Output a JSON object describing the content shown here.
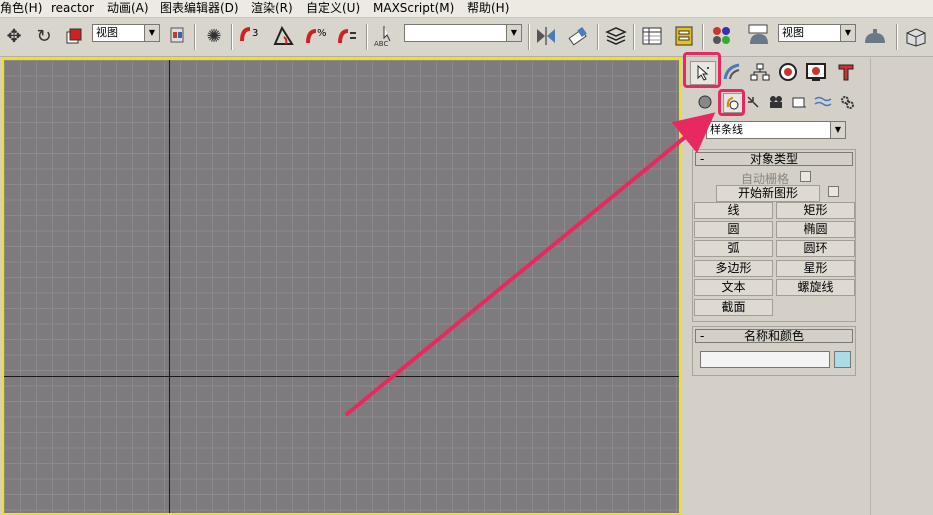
{
  "menu": [
    "角色(H)",
    "reactor",
    "动画(A)",
    "图表编辑器(D)",
    "渲染(R)",
    "自定义(U)",
    "MAXScript(M)",
    "帮助(H)"
  ],
  "toolbar": {
    "ref_coord": "视图",
    "named_selection": "",
    "render_view": "视图"
  },
  "panel": {
    "category_dropdown": "样条线",
    "object_type": {
      "title": "对象类型",
      "collapse": "-",
      "auto_grid": "自动栅格",
      "start_new_shape": "开始新图形",
      "buttons": [
        "线",
        "矩形",
        "圆",
        "椭圆",
        "弧",
        "圆环",
        "多边形",
        "星形",
        "文本",
        "螺旋线",
        "截面"
      ]
    },
    "name_color": {
      "title": "名称和颜色",
      "collapse": "-",
      "name_value": "",
      "color": "#a8dce6"
    }
  },
  "colors": {
    "viewport_border": "#f0e020",
    "highlight": "#e8295f"
  }
}
